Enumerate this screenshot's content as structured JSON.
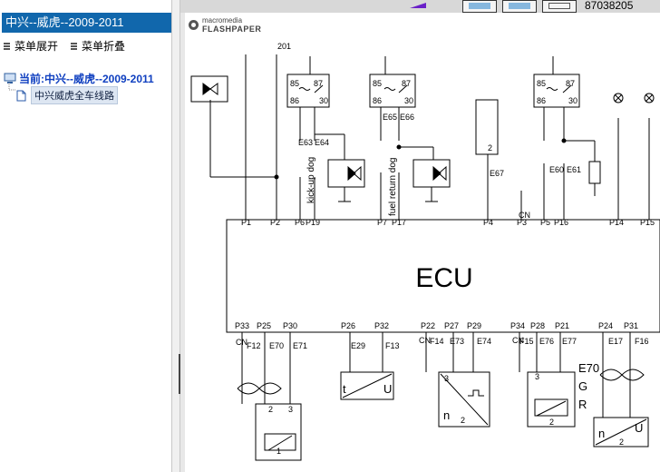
{
  "left_panel": {
    "title": "中兴--威虎--2009-2011",
    "expand_label": "菜单展开",
    "collapse_label": "菜单折叠",
    "root_label": "当前:中兴--威虎--2009-2011",
    "child_label": "中兴威虎全车线路"
  },
  "viewer": {
    "phone": "87038205",
    "logo_small": "macromedia",
    "logo_big": "FLASHPAPER"
  },
  "diagram": {
    "ecu_label": "ECU",
    "top_pins": [
      "P1",
      "P2",
      "P6",
      "P19",
      "P7",
      "P17",
      "P4",
      "P3",
      "P5",
      "P16",
      "P14",
      "P15"
    ],
    "bottom_pins": [
      "P33",
      "P25",
      "P30",
      "P26",
      "P32",
      "P22",
      "P27",
      "P29",
      "P34",
      "P28",
      "P21",
      "P24",
      "P31"
    ],
    "wire_201": "201",
    "relay_labels": [
      "85",
      "87",
      "86",
      "30"
    ],
    "connectors_top": [
      "E63",
      "E64",
      "E65",
      "E66",
      "E67",
      "E60",
      "E61"
    ],
    "connectors_bottom": [
      "F12",
      "E70",
      "E71",
      "E29",
      "F13",
      "F14",
      "E73",
      "E74",
      "F15",
      "E76",
      "E77",
      "E17",
      "F16"
    ],
    "kickdown_label": "kick-up dog",
    "fuel_return_label": "fuel return dog",
    "cn_label": "CN",
    "t_label": "t",
    "u_label": "U",
    "n_label": "n",
    "r_label": "R",
    "g_label": "G",
    "one_label": "1",
    "two_label": "2",
    "three_label": "3"
  }
}
